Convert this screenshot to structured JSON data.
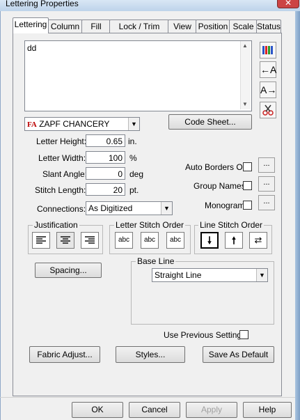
{
  "window": {
    "title": "Lettering Properties",
    "close": "✕"
  },
  "tabs": [
    {
      "label": "Lettering"
    },
    {
      "label": "Column"
    },
    {
      "label": "Fill"
    },
    {
      "label": "Lock / Trim"
    },
    {
      "label": "View"
    },
    {
      "label": "Position"
    },
    {
      "label": "Scale"
    },
    {
      "label": "Status"
    }
  ],
  "text_area": {
    "value": "dd"
  },
  "font": {
    "icon": "FA",
    "name": "ZAPF CHANCERY"
  },
  "code_sheet_label": "Code Sheet...",
  "fields": {
    "letter_height": {
      "label": "Letter Height:",
      "value": "0.65",
      "unit": "in."
    },
    "letter_width": {
      "label": "Letter Width:",
      "value": "100",
      "unit": "%"
    },
    "slant_angle": {
      "label": "Slant Angle:",
      "value": "0",
      "unit": "deg"
    },
    "stitch_length": {
      "label": "Stitch Length:",
      "value": "20",
      "unit": "pt."
    }
  },
  "connections": {
    "label": "Connections:",
    "value": "As Digitized"
  },
  "options": {
    "auto_borders": {
      "label": "Auto Borders On",
      "checked": false,
      "btn": "..."
    },
    "group_names": {
      "label": "Group Names",
      "checked": false,
      "btn": "..."
    },
    "monogram": {
      "label": "Monogram",
      "checked": false,
      "btn": "..."
    }
  },
  "justification": {
    "label": "Justification"
  },
  "letter_stitch_order": {
    "label": "Letter Stitch Order",
    "glyph": "abc"
  },
  "line_stitch_order": {
    "label": "Line Stitch Order"
  },
  "spacing_label": "Spacing...",
  "base_line": {
    "label": "Base Line",
    "value": "Straight Line"
  },
  "use_previous": {
    "label": "Use Previous Settings",
    "checked": false
  },
  "action_buttons": {
    "fabric": "Fabric Adjust...",
    "styles": "Styles...",
    "default": "Save As Default"
  },
  "dialog_buttons": {
    "ok": "OK",
    "cancel": "Cancel",
    "apply": "Apply",
    "help": "Help"
  }
}
